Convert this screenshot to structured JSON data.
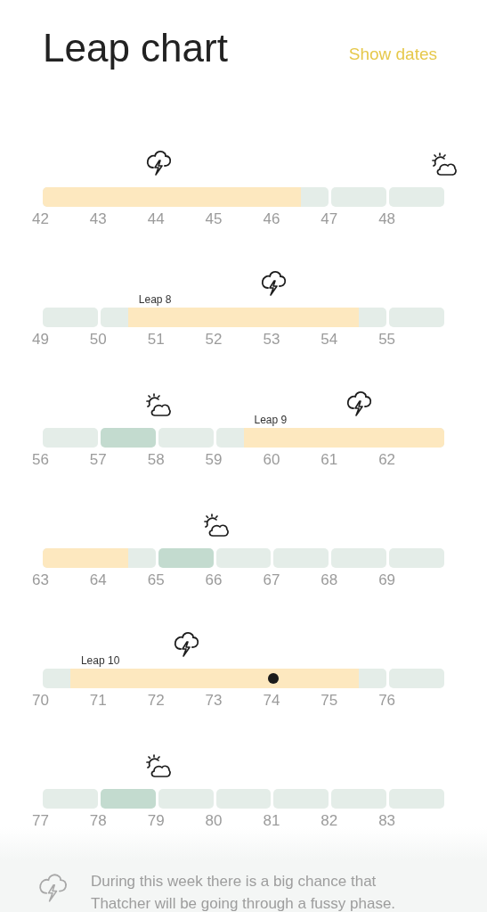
{
  "header": {
    "title": "Leap chart",
    "action": "Show dates"
  },
  "weeks": [
    {
      "days": [
        {
          "number": "42",
          "fussy_first_half": true,
          "fussy_second_half": true,
          "current": false
        },
        {
          "number": "43",
          "fussy_first_half": true,
          "fussy_second_half": true,
          "current": false
        },
        {
          "number": "44",
          "fussy_first_half": true,
          "fussy_second_half": true,
          "current": false,
          "marker_start": {
            "kind": "storm"
          }
        },
        {
          "number": "45",
          "fussy_first_half": true,
          "fussy_second_half": true,
          "current": false
        },
        {
          "number": "46",
          "fussy_first_half": true,
          "fussy_second_half": false,
          "shaded": false,
          "current": false
        },
        {
          "number": "47",
          "fussy_first_half": false,
          "fussy_second_half": false,
          "shaded": false,
          "current": false
        },
        {
          "number": "48",
          "fussy_first_half": false,
          "fussy_second_half": false,
          "shaded": false,
          "current": false,
          "marker_end": {
            "kind": "sun"
          }
        }
      ]
    },
    {
      "days": [
        {
          "number": "49",
          "fussy_first_half": false,
          "fussy_second_half": false,
          "shaded": false,
          "current": false
        },
        {
          "number": "50",
          "fussy_first_half": false,
          "fussy_second_half": true,
          "shaded": false,
          "current": false,
          "leap_label": "Leap 8"
        },
        {
          "number": "51",
          "fussy_first_half": true,
          "fussy_second_half": true,
          "current": false
        },
        {
          "number": "52",
          "fussy_first_half": true,
          "fussy_second_half": true,
          "current": false
        },
        {
          "number": "53",
          "fussy_first_half": true,
          "fussy_second_half": true,
          "current": false,
          "marker_start": {
            "kind": "storm"
          }
        },
        {
          "number": "54",
          "fussy_first_half": true,
          "fussy_second_half": false,
          "shaded": false,
          "current": false
        },
        {
          "number": "55",
          "fussy_first_half": false,
          "fussy_second_half": false,
          "shaded": false,
          "current": false
        }
      ]
    },
    {
      "days": [
        {
          "number": "56",
          "fussy_first_half": false,
          "fussy_second_half": false,
          "shaded": false,
          "current": false
        },
        {
          "number": "57",
          "fussy_first_half": false,
          "fussy_second_half": false,
          "shaded": true,
          "current": false
        },
        {
          "number": "58",
          "fussy_first_half": false,
          "fussy_second_half": false,
          "shaded": false,
          "current": false,
          "marker_start": {
            "kind": "sun"
          }
        },
        {
          "number": "59",
          "fussy_first_half": false,
          "fussy_second_half": true,
          "shaded": false,
          "current": false,
          "leap_label": "Leap 9"
        },
        {
          "number": "60",
          "fussy_first_half": true,
          "fussy_second_half": true,
          "current": false
        },
        {
          "number": "61",
          "fussy_first_half": true,
          "fussy_second_half": true,
          "current": false,
          "marker_middle": {
            "kind": "storm"
          }
        },
        {
          "number": "62",
          "fussy_first_half": true,
          "fussy_second_half": true,
          "current": false
        }
      ]
    },
    {
      "days": [
        {
          "number": "63",
          "fussy_first_half": true,
          "fussy_second_half": true,
          "current": false
        },
        {
          "number": "64",
          "fussy_first_half": true,
          "fussy_second_half": false,
          "shaded": false,
          "current": false
        },
        {
          "number": "65",
          "fussy_first_half": false,
          "fussy_second_half": false,
          "shaded": true,
          "current": false
        },
        {
          "number": "66",
          "fussy_first_half": false,
          "fussy_second_half": false,
          "shaded": false,
          "current": false,
          "marker_start": {
            "kind": "sun"
          }
        },
        {
          "number": "67",
          "fussy_first_half": false,
          "fussy_second_half": false,
          "shaded": false,
          "current": false
        },
        {
          "number": "68",
          "fussy_first_half": false,
          "fussy_second_half": false,
          "shaded": false,
          "current": false
        },
        {
          "number": "69",
          "fussy_first_half": false,
          "fussy_second_half": false,
          "shaded": false,
          "current": false
        }
      ]
    },
    {
      "days": [
        {
          "number": "70",
          "fussy_first_half": false,
          "fussy_second_half": true,
          "shaded": false,
          "current": false,
          "leap_label": "Leap 10"
        },
        {
          "number": "71",
          "fussy_first_half": true,
          "fussy_second_half": true,
          "current": false
        },
        {
          "number": "72",
          "fussy_first_half": true,
          "fussy_second_half": true,
          "current": false,
          "marker_middle": {
            "kind": "storm"
          }
        },
        {
          "number": "73",
          "fussy_first_half": true,
          "fussy_second_half": true,
          "current": false
        },
        {
          "number": "74",
          "fussy_first_half": true,
          "fussy_second_half": true,
          "current": true
        },
        {
          "number": "75",
          "fussy_first_half": true,
          "fussy_second_half": false,
          "shaded": false,
          "current": false
        },
        {
          "number": "76",
          "fussy_first_half": false,
          "fussy_second_half": false,
          "shaded": false,
          "current": false
        }
      ]
    },
    {
      "days": [
        {
          "number": "77",
          "fussy_first_half": false,
          "fussy_second_half": false,
          "shaded": false,
          "current": false
        },
        {
          "number": "78",
          "fussy_first_half": false,
          "fussy_second_half": false,
          "shaded": true,
          "current": false
        },
        {
          "number": "79",
          "fussy_first_half": false,
          "fussy_second_half": false,
          "shaded": false,
          "current": false,
          "marker_start": {
            "kind": "sun"
          }
        },
        {
          "number": "80",
          "fussy_first_half": false,
          "fussy_second_half": false,
          "shaded": false,
          "current": false
        },
        {
          "number": "81",
          "fussy_first_half": false,
          "fussy_second_half": false,
          "shaded": false,
          "current": false
        },
        {
          "number": "82",
          "fussy_first_half": false,
          "fussy_second_half": false,
          "shaded": false,
          "current": false
        },
        {
          "number": "83",
          "fussy_first_half": false,
          "fussy_second_half": false,
          "shaded": false,
          "current": false
        }
      ]
    }
  ],
  "info": {
    "text": "During this week there is a big chance that Thatcher will be going through a fussy phase."
  }
}
